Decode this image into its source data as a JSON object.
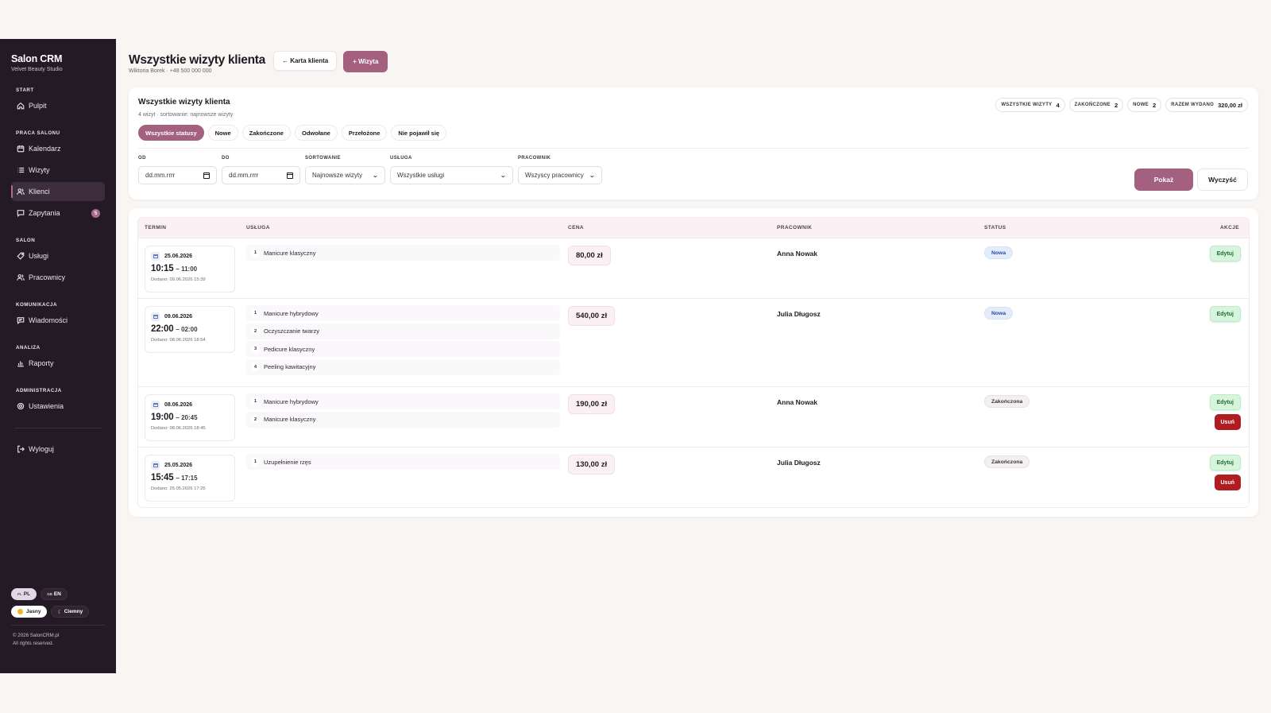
{
  "sidebar": {
    "brand": "Salon CRM",
    "studio": "Velvet Beauty Studio",
    "sections": {
      "start": "START",
      "praca": "PRACA SALONU",
      "salon": "SALON",
      "komunikacja": "KOMUNIKACJA",
      "analiza": "ANALIZA",
      "administracja": "ADMINISTRACJA"
    },
    "items": {
      "pulpit": "Pulpit",
      "kalendarz": "Kalendarz",
      "wizyty": "Wizyty",
      "klienci": "Klienci",
      "zapytania": "Zapytania",
      "zapytania_count": "5",
      "uslugi": "Usługi",
      "pracownicy": "Pracownicy",
      "wiadomosci": "Wiadomości",
      "raporty": "Raporty",
      "ustawienia": "Ustawienia",
      "wyloguj": "Wyloguj"
    },
    "active_item": "klienci",
    "lang": {
      "pl_flag": "PL",
      "pl": "PL",
      "en_flag": "GB",
      "en": "EN",
      "selected": "PL"
    },
    "theme": {
      "light": "Jasny",
      "dark": "Ciemny",
      "selected": "Jasny"
    },
    "copyright": "© 2026 SalonCRM.pl",
    "rights": "All rights reserved."
  },
  "header": {
    "title": "Wszystkie wizyty klienta",
    "client": "Wiktoria Borek · +48 500 000 000",
    "back_button": "← Karta klienta",
    "add_button": "+ Wizyta"
  },
  "filters": {
    "title": "Wszystkie wizyty klienta",
    "subtitle": "4 wizyt · sortowanie: najnowsze wizyty",
    "stats": [
      {
        "label": "WSZYSTKIE WIZYTY",
        "value": "4"
      },
      {
        "label": "ZAKOŃCZONE",
        "value": "2"
      },
      {
        "label": "NOWE",
        "value": "2"
      },
      {
        "label": "RAZEM WYDANO",
        "value": "320,00 zł"
      }
    ],
    "tabs": [
      "Wszystkie statusy",
      "Nowe",
      "Zakończone",
      "Odwołane",
      "Przełożone",
      "Nie pojawił się"
    ],
    "active_tab": "Wszystkie statusy",
    "fields": {
      "od_label": "OD",
      "od_value": "dd.mm.rrrr",
      "do_label": "DO",
      "do_value": "dd.mm.rrrr",
      "sort_label": "SORTOWANIE",
      "sort_value": "Najnowsze wizyty",
      "service_label": "USŁUGA",
      "service_value": "Wszystkie usługi",
      "worker_label": "PRACOWNIK",
      "worker_value": "Wszyscy pracownicy"
    },
    "show_button": "Pokaż",
    "clear_button": "Wyczyść"
  },
  "table": {
    "columns": [
      "TERMIN",
      "USŁUGA",
      "CENA",
      "PRACOWNIK",
      "STATUS",
      "AKCJE"
    ],
    "rows": [
      {
        "date": "25.06.2026",
        "start": "10:15",
        "end": "– 11:00",
        "added": "Dodano: 09.06.2026 15:39",
        "services": [
          [
            "1",
            "Manicure klasyczny"
          ]
        ],
        "price": "80,00 zł",
        "worker": "Anna Nowak",
        "status": "Nowa",
        "status_kind": "new",
        "edit": "Edytuj",
        "delete": ""
      },
      {
        "date": "09.06.2026",
        "start": "22:00",
        "end": "– 02:00",
        "added": "Dodano: 08.06.2026 18:54",
        "services": [
          [
            "1",
            "Manicure hybrydowy"
          ],
          [
            "2",
            "Oczyszczanie twarzy"
          ],
          [
            "3",
            "Pedicure klasyczny"
          ],
          [
            "4",
            "Peeling kawitacyjny"
          ]
        ],
        "price": "540,00 zł",
        "worker": "Julia Długosz",
        "status": "Nowa",
        "status_kind": "new",
        "edit": "Edytuj",
        "delete": ""
      },
      {
        "date": "08.06.2026",
        "start": "19:00",
        "end": "– 20:45",
        "added": "Dodano: 08.06.2026 18:45",
        "services": [
          [
            "1",
            "Manicure hybrydowy"
          ],
          [
            "2",
            "Manicure klasyczny"
          ]
        ],
        "price": "190,00 zł",
        "worker": "Anna Nowak",
        "status": "Zakończona",
        "status_kind": "done",
        "edit": "Edytuj",
        "delete": "Usuń"
      },
      {
        "date": "25.05.2026",
        "start": "15:45",
        "end": "– 17:15",
        "added": "Dodano: 25.05.2026 17:25",
        "services": [
          [
            "1",
            "Uzupełnienie rzęs"
          ]
        ],
        "price": "130,00 zł",
        "worker": "Julia Długosz",
        "status": "Zakończona",
        "status_kind": "done",
        "edit": "Edytuj",
        "delete": "Usuń"
      }
    ]
  },
  "colors": {
    "sidebar_bg": "#231a25",
    "accent": "#a3607f",
    "page_bg": "#f8f5f2",
    "edit_bg": "#d7f5dd",
    "delete_bg": "#b01c22",
    "status_new_bg": "#e3ecfb"
  }
}
